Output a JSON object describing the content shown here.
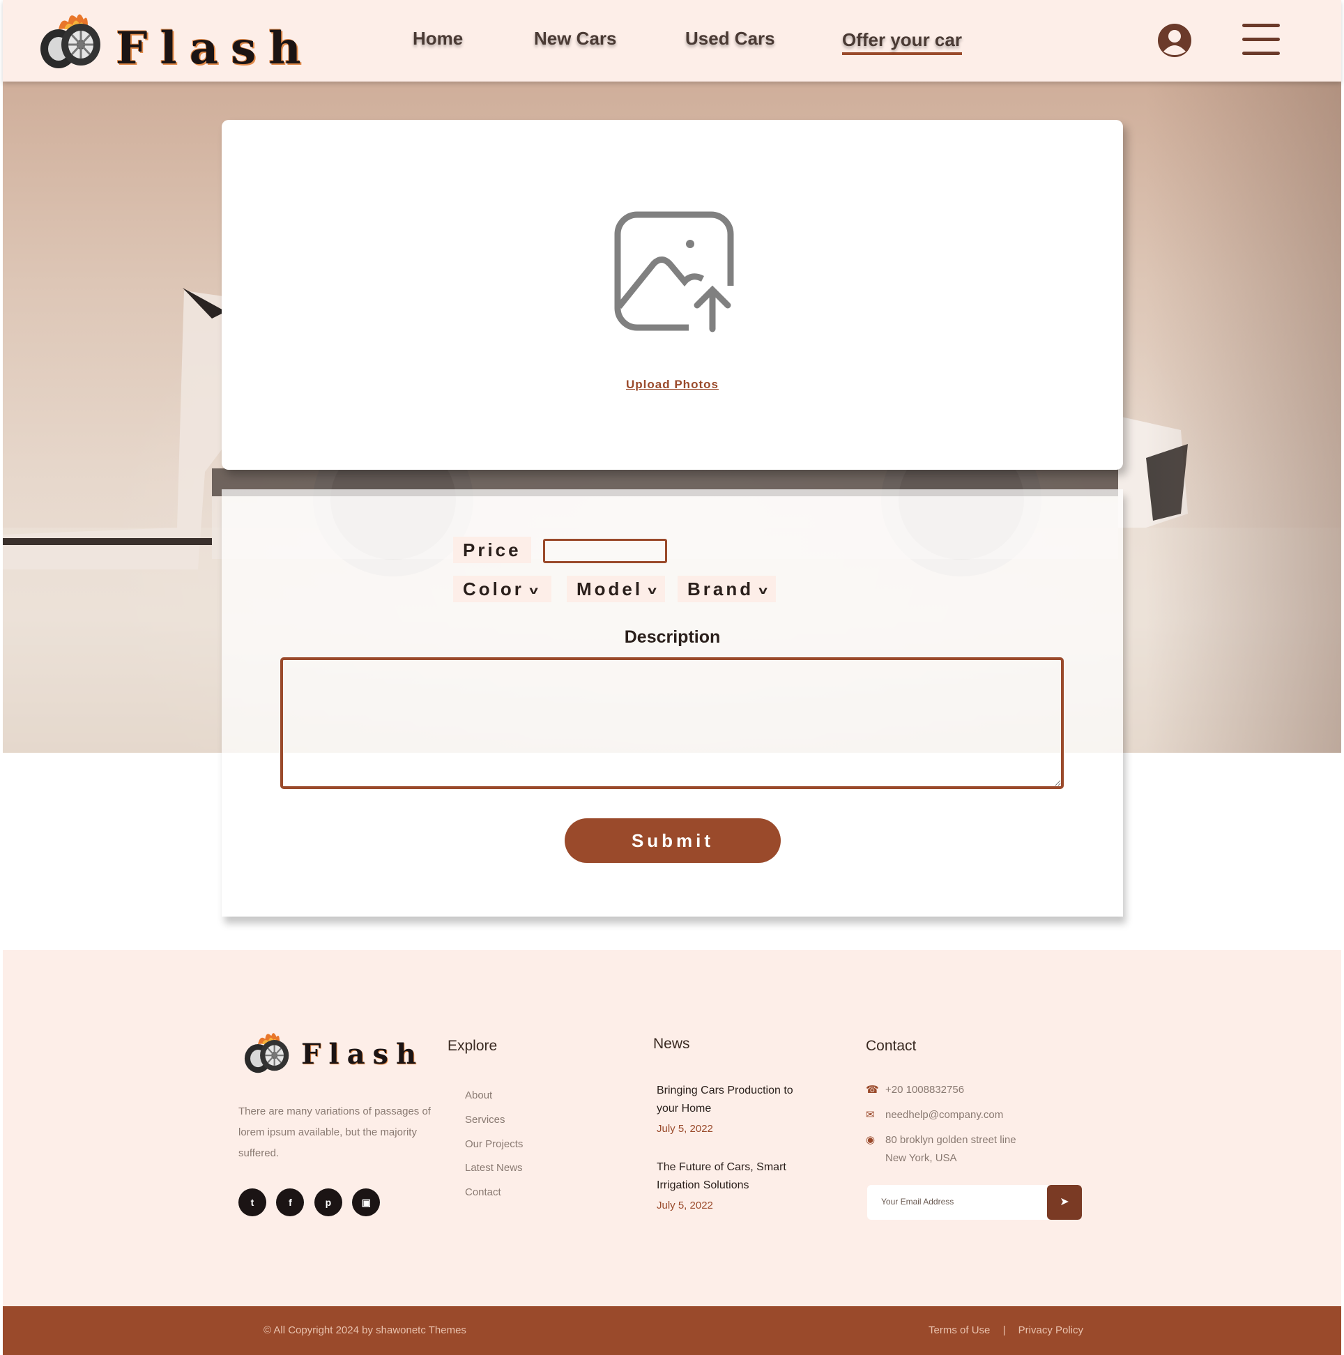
{
  "brand": {
    "name": "Flash"
  },
  "nav": {
    "links": [
      {
        "label": "Home"
      },
      {
        "label": "New Cars"
      },
      {
        "label": "Used Cars"
      },
      {
        "label": "Offer your car",
        "active": true
      }
    ],
    "icons": {
      "user": "user-circle-icon",
      "menu": "hamburger-menu-icon"
    }
  },
  "upload": {
    "icon": "image-upload-icon",
    "link_label": "Upload Photos"
  },
  "form": {
    "price_label": "Price",
    "price_value": "",
    "color_label": "Color",
    "model_label": "Model",
    "brand_label": "Brand",
    "description_title": "Description",
    "description_value": "",
    "submit_label": "Submit"
  },
  "footer": {
    "brand_name": "Flash",
    "description": "There are many variations of passages of lorem ipsum available, but the majority suffered.",
    "socials": [
      "twitter-icon",
      "facebook-icon",
      "pinterest-icon",
      "instagram-icon"
    ],
    "explore": {
      "title": "Explore",
      "links": [
        "About",
        "Services",
        "Our Projects",
        "Latest News",
        "Contact"
      ]
    },
    "news": {
      "title": "News",
      "items": [
        {
          "title": "Bringing Cars Production to your Home",
          "date": "July 5, 2022"
        },
        {
          "title": "The Future of Cars, Smart Irrigation Solutions",
          "date": "July 5, 2022"
        }
      ]
    },
    "contact": {
      "title": "Contact",
      "phone": "+20 1008832756",
      "email": "needhelp@company.com",
      "address_line1": "80 broklyn golden street line",
      "address_line2": "New York, USA",
      "email_placeholder": "Your Email Address"
    },
    "copyright": "© All Copyright 2024 by shawonetc Themes",
    "terms": "Terms of Use",
    "privacy": "Privacy Policy",
    "separator": "|"
  },
  "colors": {
    "accent": "#9a4a2b",
    "nav_bg": "#fdeee8",
    "footer_bg": "#fdeee8",
    "bottom_bar": "#9a4a2b"
  }
}
